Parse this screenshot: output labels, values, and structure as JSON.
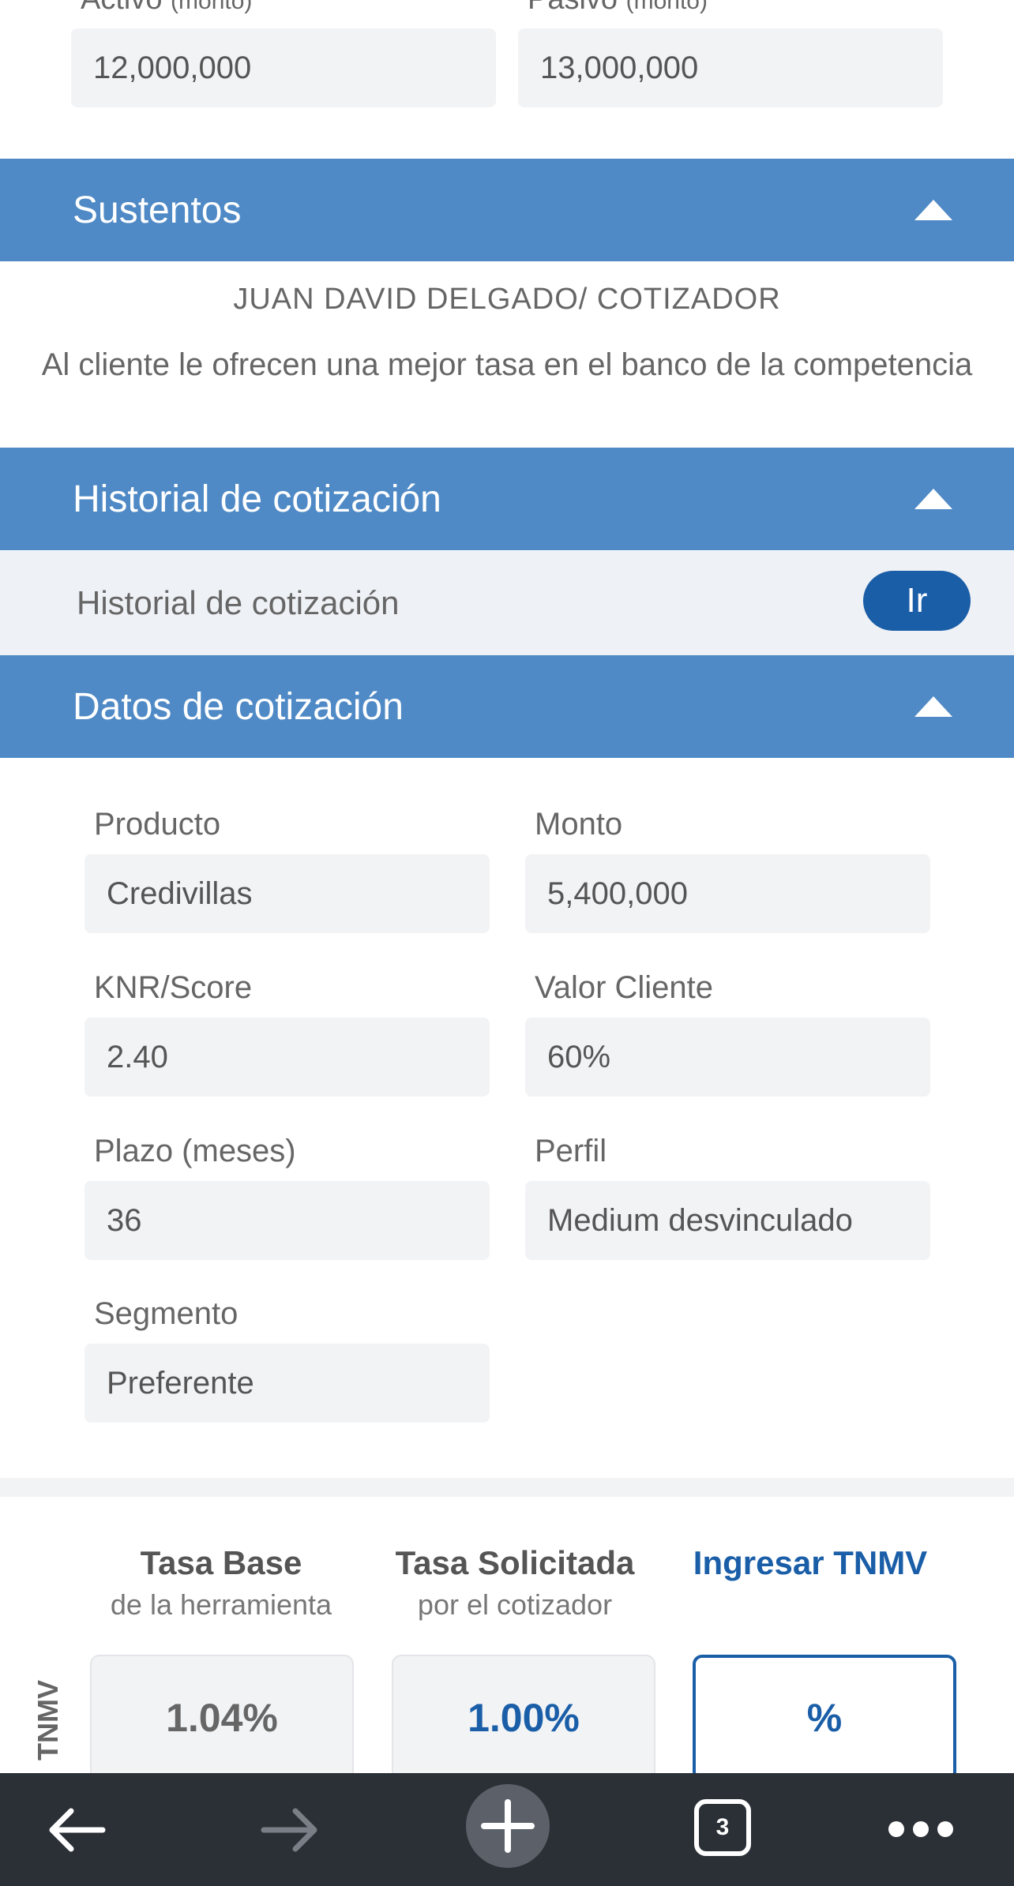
{
  "top_fields": {
    "activo_label": "Activo",
    "activo_sub": "(monto)",
    "activo_value": "12,000,000",
    "pasivo_label": "Pasivo",
    "pasivo_sub": "(monto)",
    "pasivo_value": "13,000,000"
  },
  "sustentos": {
    "title": "Sustentos",
    "author": "JUAN DAVID DELGADO/ COTIZADOR",
    "text": "Al cliente le ofrecen una mejor tasa en el banco de la competencia"
  },
  "historial": {
    "title": "Historial de cotización",
    "row_label": "Historial de cotización",
    "button": "Ir"
  },
  "datos": {
    "title": "Datos de cotización",
    "producto_label": "Producto",
    "producto_value": "Credivillas",
    "monto_label": "Monto",
    "monto_value": "5,400,000",
    "knr_label": "KNR/Score",
    "knr_value": "2.40",
    "valor_label": "Valor Cliente",
    "valor_value": "60%",
    "plazo_label": "Plazo (meses)",
    "plazo_value": "36",
    "perfil_label": "Perfil",
    "perfil_value": "Medium desvinculado",
    "segmento_label": "Segmento",
    "segmento_value": "Preferente"
  },
  "tasas": {
    "row_label": "TNMV",
    "base_title": "Tasa Base",
    "base_sub": "de la herramienta",
    "base_value": "1.04%",
    "solicitada_title": "Tasa Solicitada",
    "solicitada_sub": "por el cotizador",
    "solicitada_value": "1.00%",
    "ingresar_title": "Ingresar TNMV",
    "ingresar_value": "%"
  },
  "browser": {
    "tab_count": "3"
  },
  "colors": {
    "section_blue": "#4f8ac6",
    "button_blue": "#1a5ea8",
    "field_bg": "#f2f3f5",
    "browser_bar": "#2b2f36"
  }
}
